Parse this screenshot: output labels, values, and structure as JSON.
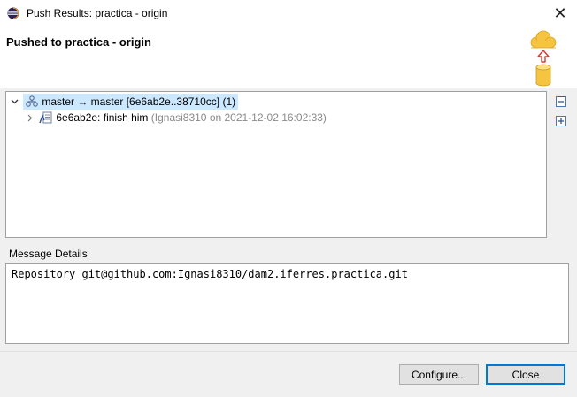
{
  "window": {
    "title": "Push Results: practica - origin",
    "icons": {
      "app": "eclipse-icon",
      "close": "close-icon"
    },
    "close_glyph": "✕"
  },
  "header": {
    "title": "Pushed to practica - origin",
    "graphic": "push-cloud-repository-graphic"
  },
  "tree": {
    "ref_row": {
      "label": "master → master [6e6ab2e..38710cc] (1)",
      "icon": "branch-icon",
      "expanded": true
    },
    "commit_row": {
      "label": "6e6ab2e: finish him",
      "meta": "(Ignasi8310 on 2021-12-02 16:02:33)",
      "icon": "commit-icon",
      "expanded": false
    },
    "side_buttons": [
      "collapse-all-icon",
      "expand-all-icon"
    ]
  },
  "message_details": {
    "label": "Message Details",
    "text": "Repository git@github.com:Ignasi8310/dam2.iferres.practica.git"
  },
  "buttons": {
    "configure": "Configure...",
    "close": "Close"
  },
  "colors": {
    "selection": "#cce8ff",
    "accent": "#0078d7",
    "cloud": "#f5c542",
    "arrow": "#d63a2f"
  }
}
